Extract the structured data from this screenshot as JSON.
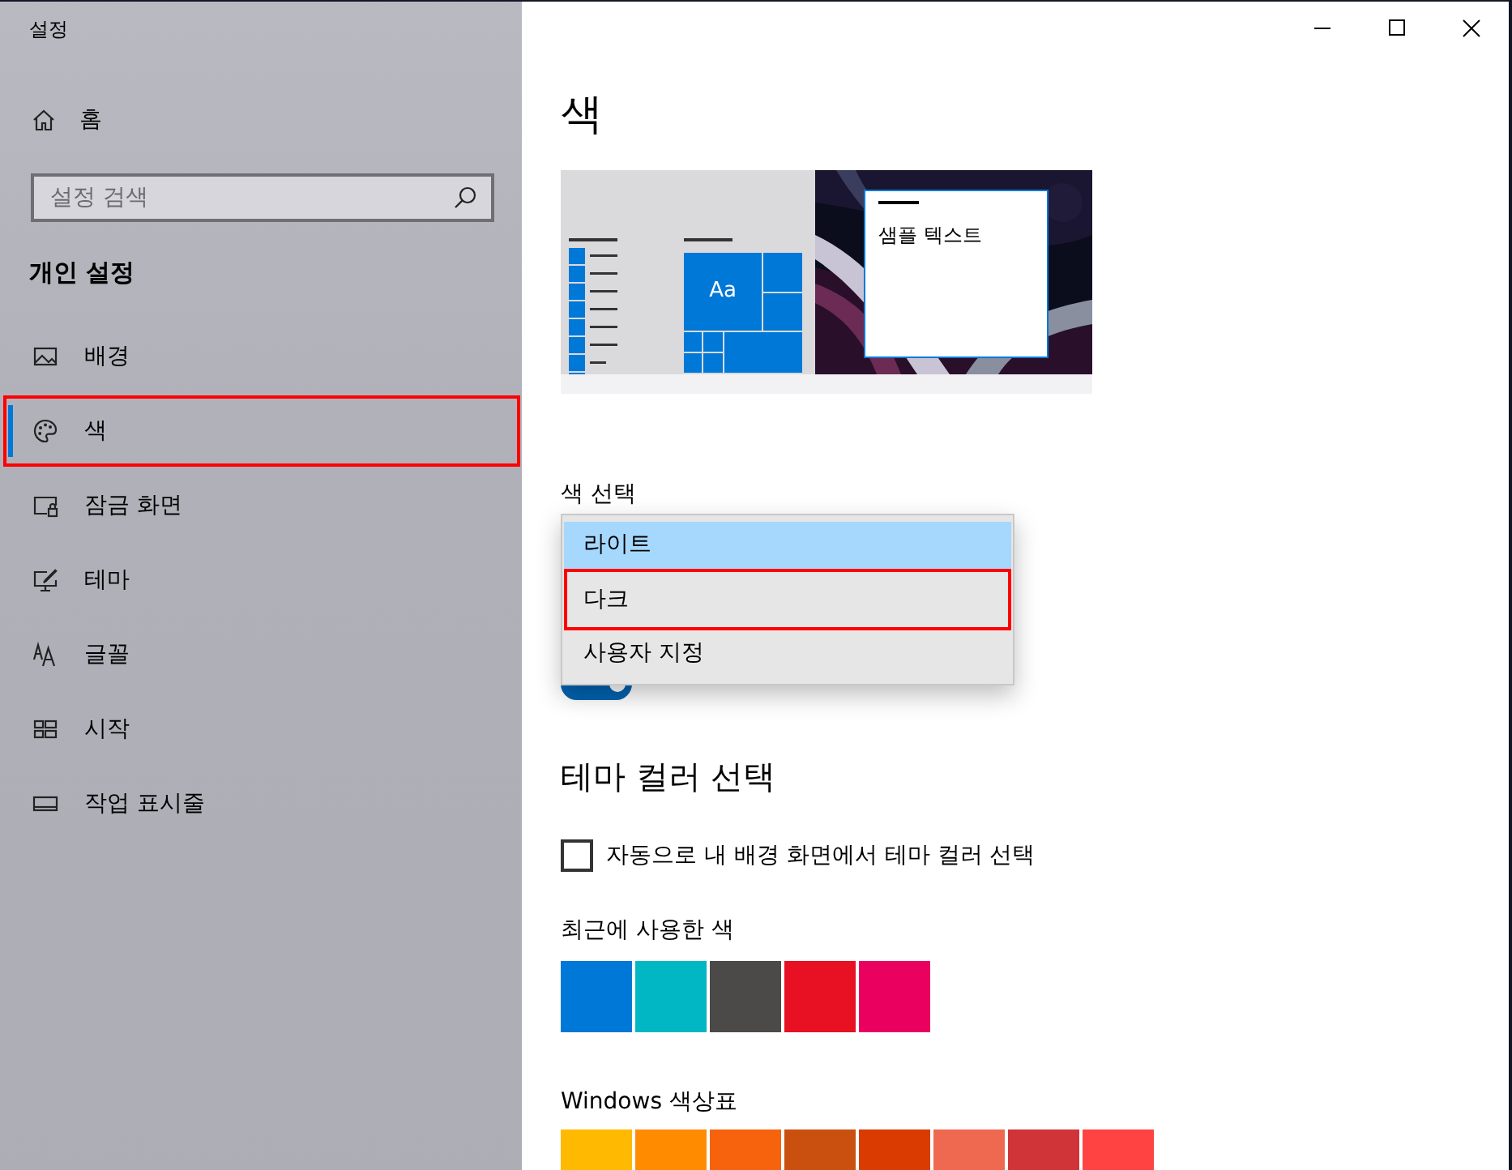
{
  "window": {
    "title": "설정"
  },
  "sidebar": {
    "home": {
      "label": "홈"
    },
    "search": {
      "placeholder": "설정 검색"
    },
    "section_title": "개인 설정",
    "items": [
      {
        "label": "배경",
        "kind": "background",
        "selected": false,
        "highlighted": false
      },
      {
        "label": "색",
        "kind": "colors",
        "selected": true,
        "highlighted": true
      },
      {
        "label": "잠금 화면",
        "kind": "lockscreen",
        "selected": false,
        "highlighted": false
      },
      {
        "label": "테마",
        "kind": "themes",
        "selected": false,
        "highlighted": false
      },
      {
        "label": "글꼴",
        "kind": "fonts",
        "selected": false,
        "highlighted": false
      },
      {
        "label": "시작",
        "kind": "start",
        "selected": false,
        "highlighted": false
      },
      {
        "label": "작업 표시줄",
        "kind": "taskbar",
        "selected": false,
        "highlighted": false
      }
    ]
  },
  "page": {
    "title": "색",
    "preview": {
      "tile_label": "Aa",
      "sample_text": "샘플 텍스트"
    },
    "color_mode": {
      "label": "색 선택",
      "options": [
        {
          "label": "라이트",
          "selected": true,
          "highlighted": false
        },
        {
          "label": "다크",
          "selected": false,
          "highlighted": true
        },
        {
          "label": "사용자 지정",
          "selected": false,
          "highlighted": false
        }
      ],
      "toggle": {
        "on": true
      }
    },
    "accent": {
      "title": "테마 컬러 선택",
      "auto_checkbox": {
        "label": "자동으로 내 배경 화면에서 테마 컬러 선택",
        "checked": false
      },
      "recent": {
        "label": "최근에 사용한 색",
        "swatches": [
          {
            "color": "#0078d7"
          },
          {
            "color": "#00b7c3"
          },
          {
            "color": "#4c4a48"
          },
          {
            "color": "#e81123"
          },
          {
            "color": "#ea005e"
          }
        ]
      },
      "palette": {
        "label": "Windows 색상표",
        "swatches": [
          {
            "color": "#ffb900"
          },
          {
            "color": "#ff8c00"
          },
          {
            "color": "#f7630c"
          },
          {
            "color": "#ca5010"
          },
          {
            "color": "#da3b01"
          },
          {
            "color": "#ef6950"
          },
          {
            "color": "#d13438"
          },
          {
            "color": "#ff4343"
          }
        ]
      }
    }
  }
}
